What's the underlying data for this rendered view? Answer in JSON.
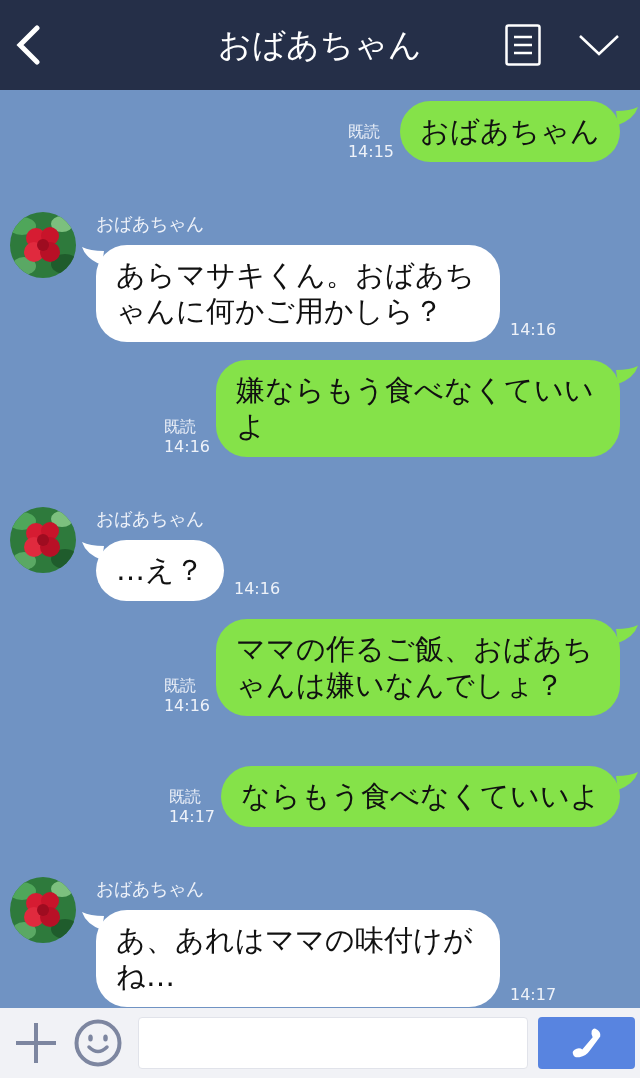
{
  "header": {
    "title": "おばあちゃん"
  },
  "messages": [
    {
      "kind": "sent",
      "text": "おばあちゃん",
      "read": "既読",
      "time": "14:15"
    },
    {
      "kind": "received",
      "sender": "おばあちゃん",
      "text": "あらマサキくん。おばあちゃんに何かご用かしら？",
      "time": "14:16"
    },
    {
      "kind": "sent",
      "text": "嫌ならもう食べなくていいよ",
      "read": "既読",
      "time": "14:16"
    },
    {
      "kind": "received",
      "sender": "おばあちゃん",
      "text": "…え？",
      "time": "14:16"
    },
    {
      "kind": "sent",
      "text": "ママの作るご飯、おばあちゃんは嫌いなんでしょ？",
      "read": "既読",
      "time": "14:16"
    },
    {
      "kind": "sent",
      "text": "ならもう食べなくていいよ",
      "read": "既読",
      "time": "14:17"
    },
    {
      "kind": "received",
      "sender": "おばあちゃん",
      "text": "あ、あれはママの味付けがね…",
      "time": "14:17"
    }
  ]
}
